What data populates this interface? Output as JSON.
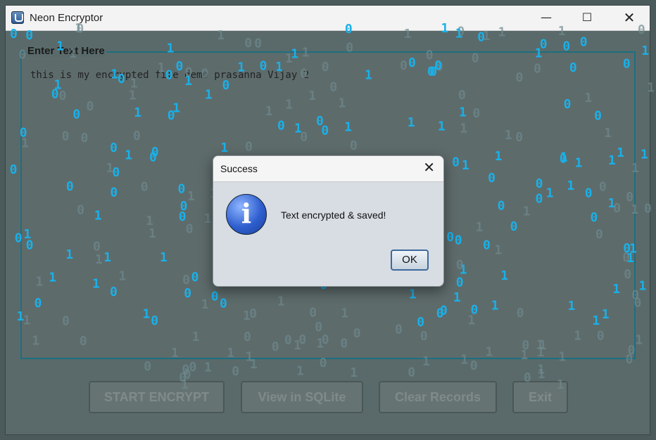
{
  "window": {
    "title": "Neon Encryptor",
    "app_icon": "java-cup-icon",
    "controls": {
      "minimize": "—",
      "maximize": "☐",
      "close": "✕"
    }
  },
  "text_area": {
    "label": "Enter Text Here",
    "content": "this is my encrypted file demo prasanna Vijay 2"
  },
  "buttons": {
    "start": "START ENCRYPT",
    "view": "View in SQLite",
    "clear": "Clear Records",
    "exit": "Exit"
  },
  "dialog": {
    "title": "Success",
    "close": "✕",
    "icon": "info-icon",
    "message": "Text encrypted & saved!",
    "ok_label": "OK"
  },
  "colors": {
    "rain_bright": "#1ab0e8",
    "rain_dim": "#6f8a8f",
    "border_accent": "#1b6f80"
  }
}
